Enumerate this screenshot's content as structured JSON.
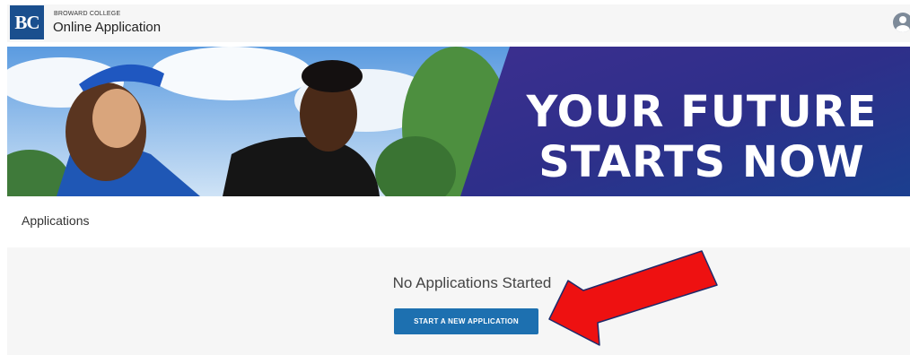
{
  "header": {
    "brand_small": "BROWARD COLLEGE",
    "title": "Online Application",
    "logo_text": "BC",
    "user_icon": "user-avatar-icon"
  },
  "banner": {
    "line1": "YOUR FUTURE",
    "line2": "STARTS NOW"
  },
  "applications": {
    "heading": "Applications",
    "empty_message": "No Applications Started",
    "start_button": "START A NEW APPLICATION"
  },
  "annotation": {
    "arrow_icon": "red-arrow-icon",
    "arrow_color": "#ee1111"
  },
  "colors": {
    "brand_blue": "#1a4f8e",
    "button_blue": "#1d70b0",
    "banner_purple": "#2e2f8a"
  }
}
